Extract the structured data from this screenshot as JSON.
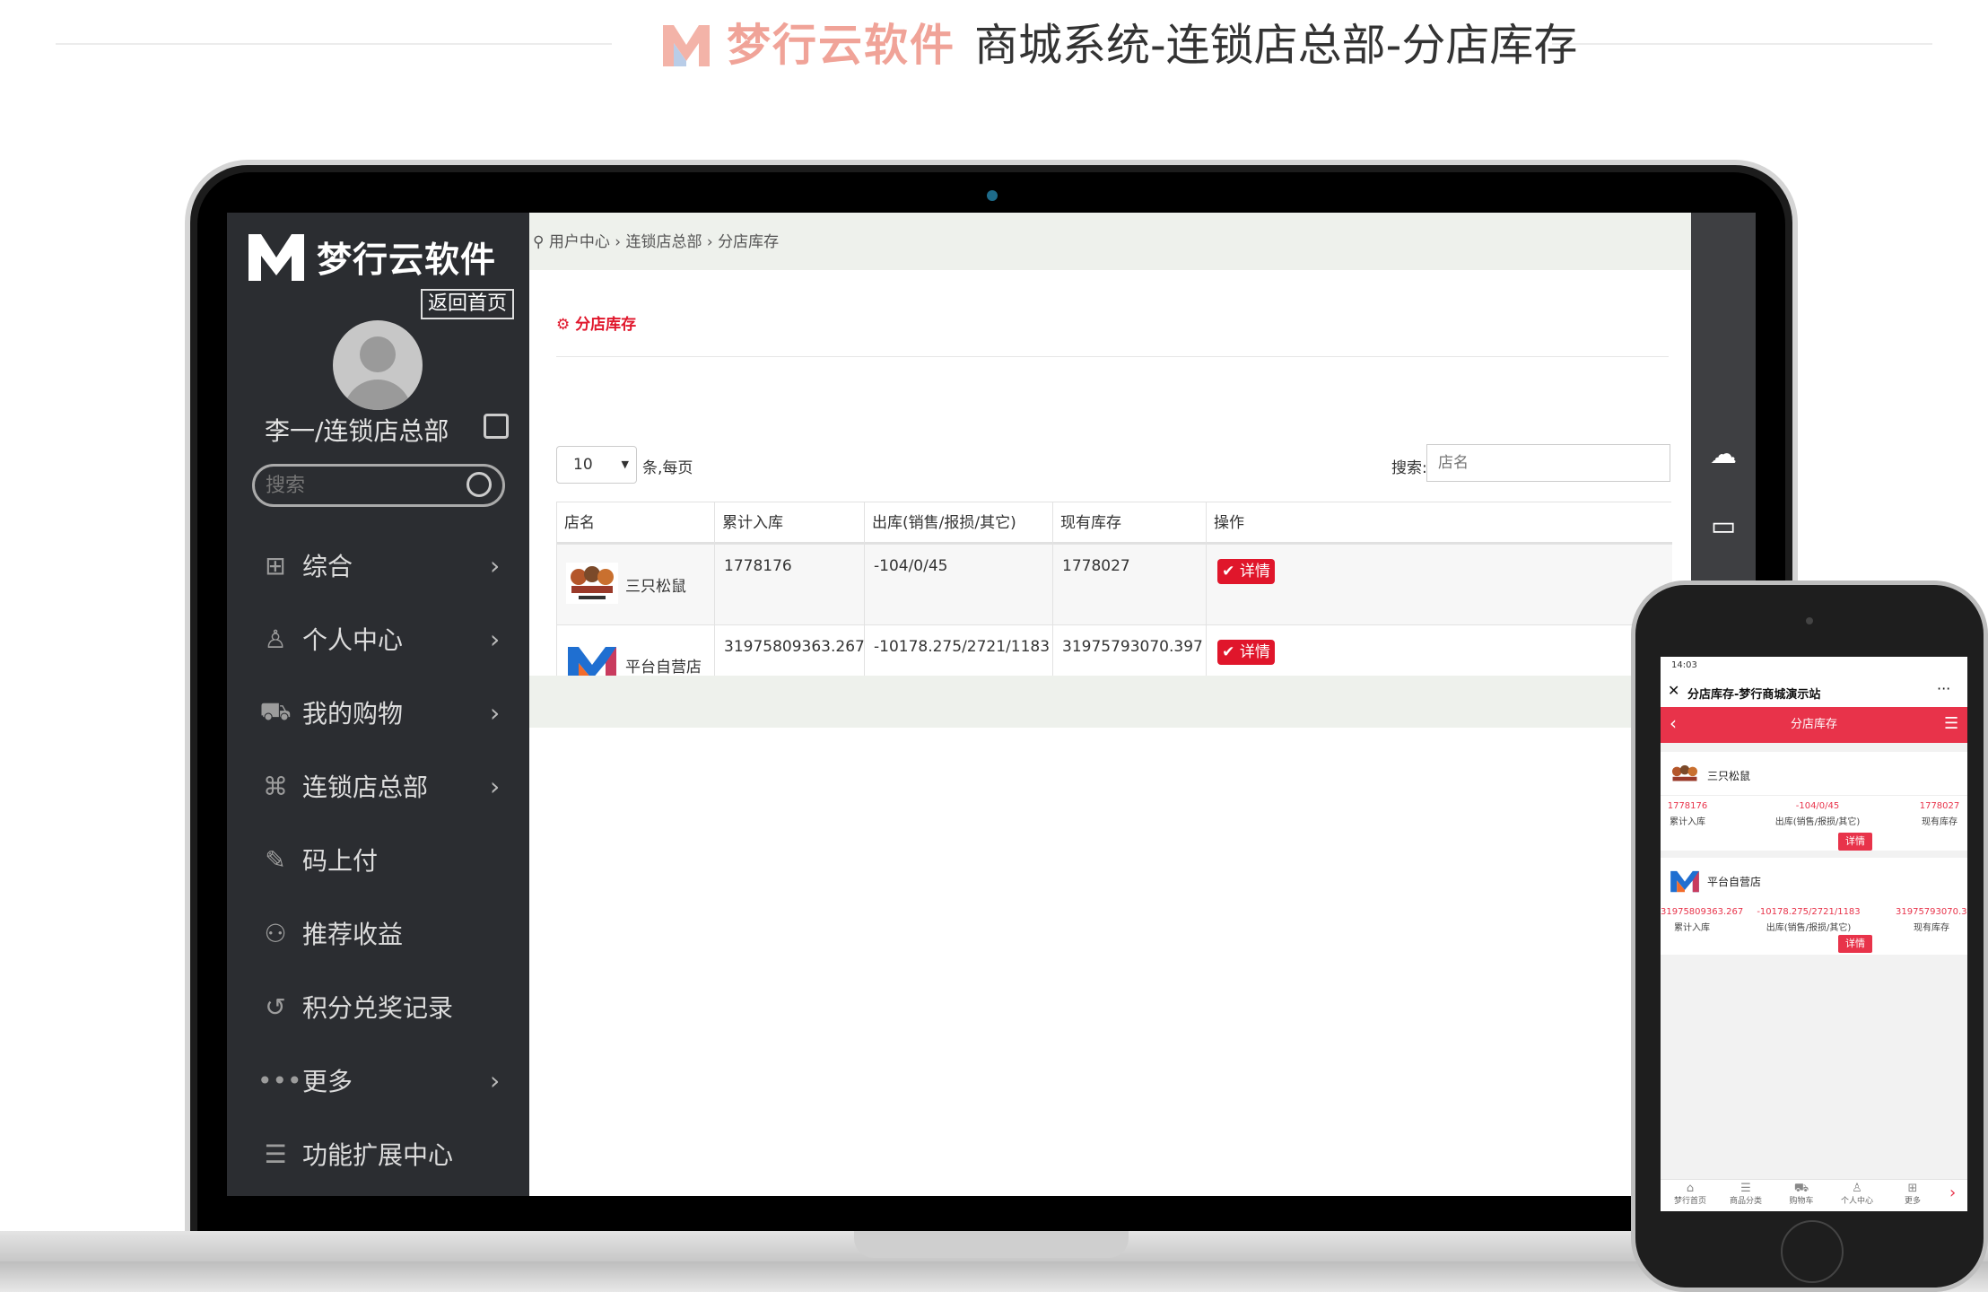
{
  "banner": {
    "brand": "梦行云软件",
    "title": "商城系统-连锁店总部-分店库存"
  },
  "sidebar": {
    "brand": "梦行云软件",
    "home_button": "返回首页",
    "user_name": "李一/连锁店总部",
    "search_placeholder": "搜索",
    "items": [
      {
        "label": "综合",
        "icon": "grid-icon",
        "arrow": true
      },
      {
        "label": "个人中心",
        "icon": "user-icon",
        "arrow": true
      },
      {
        "label": "我的购物",
        "icon": "cart-icon",
        "arrow": true
      },
      {
        "label": "连锁店总部",
        "icon": "command-icon",
        "arrow": true
      },
      {
        "label": "码上付",
        "icon": "pencil-icon",
        "arrow": false
      },
      {
        "label": "推荐收益",
        "icon": "share-icon",
        "arrow": false
      },
      {
        "label": "积分兑奖记录",
        "icon": "history-icon",
        "arrow": false
      },
      {
        "label": "更多",
        "icon": "dots-icon",
        "arrow": true
      },
      {
        "label": "功能扩展中心",
        "icon": "menu-icon",
        "arrow": false
      }
    ]
  },
  "breadcrumb": {
    "items": [
      "用户中心",
      "连锁店总部",
      "分店库存"
    ],
    "sep": "›"
  },
  "panel": {
    "title": "分店库存",
    "per_page_value": "10",
    "per_page_suffix": "条,每页",
    "search_label": "搜索:",
    "search_placeholder": "店名"
  },
  "table": {
    "headers": [
      "店名",
      "累计入库",
      "出库(销售/报损/其它)",
      "现有库存",
      "操作"
    ],
    "rows": [
      {
        "name": "三只松鼠",
        "in": "1778176",
        "out": "-104/0/45",
        "stock": "1778027",
        "action": "详情"
      },
      {
        "name": "平台自营店",
        "in": "31975809363.267",
        "out": "-10178.275/2721/1183",
        "stock": "31975793070.397",
        "action": "详情"
      }
    ]
  },
  "phone": {
    "status_time": "14:03",
    "page_title": "分店库存-梦行商城演示站",
    "header_title": "分店库存",
    "labels": {
      "in": "累计入库",
      "out": "出库(销售/报损/其它)",
      "stock": "现有库存"
    },
    "tabs": [
      "梦行首页",
      "商品分类",
      "购物车",
      "个人中心",
      "更多"
    ]
  },
  "colors": {
    "accent": "#e0162b",
    "sidebar": "#2b2d31",
    "crumb_bg": "#eef1ec",
    "brand_logo_blue": "#1f6fd1",
    "brand_logo_orange": "#f26b2a"
  }
}
